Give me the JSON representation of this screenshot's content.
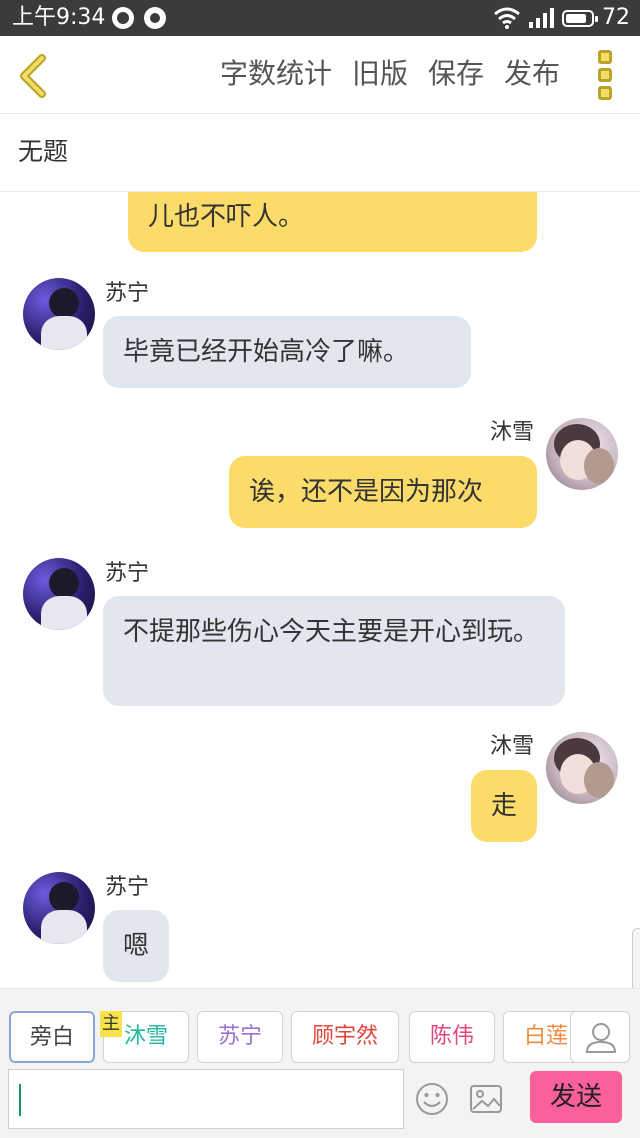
{
  "status_bar": {
    "time": "上午9:34",
    "battery": "72"
  },
  "toolbar": {
    "actions": [
      "字数统计",
      "旧版",
      "保存",
      "发布"
    ]
  },
  "title": "无题",
  "messages": [
    {
      "type": "partial",
      "text": "儿也不吓人。"
    },
    {
      "type": "left",
      "name": "苏宁",
      "text": "毕竟已经开始高冷了嘛。"
    },
    {
      "type": "right",
      "name": "沐雪",
      "text": "诶，还不是因为那次"
    },
    {
      "type": "left",
      "name": "苏宁",
      "text": "不提那些伤心今天主要是开心到玩。"
    },
    {
      "type": "right",
      "name": "沐雪",
      "text": "走"
    },
    {
      "type": "left",
      "name": "苏宁",
      "text": "嗯"
    }
  ],
  "roles": [
    {
      "label": "旁白",
      "color": "#444444"
    },
    {
      "label": "沐雪",
      "color": "#20b5a0"
    },
    {
      "label": "苏宁",
      "color": "#9b6fd4"
    },
    {
      "label": "顾宇然",
      "color": "#e0453b"
    },
    {
      "label": "陈伟",
      "color": "#e0457e"
    },
    {
      "label": "白莲",
      "color": "#f08a3c"
    }
  ],
  "role_badge": "主",
  "composer": {
    "placeholder": "",
    "send_label": "发送"
  }
}
